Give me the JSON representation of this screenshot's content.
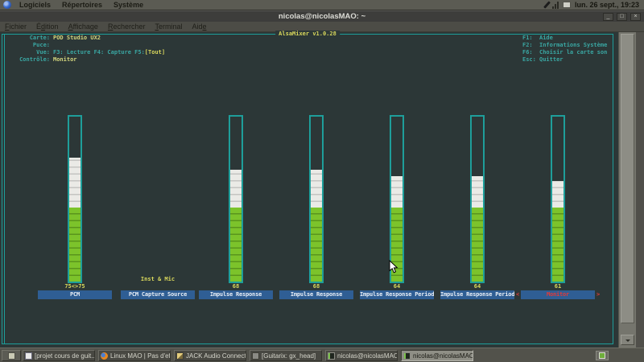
{
  "panel": {
    "menus": [
      "Logiciels",
      "Répertoires",
      "Système"
    ],
    "clock": "lun. 26 sept., 19:23"
  },
  "window": {
    "title": "nicolas@nicolasMAO: ~",
    "menus": [
      {
        "label": "Fichier",
        "u": 0
      },
      {
        "label": "Édition",
        "u": 1
      },
      {
        "label": "Affichage",
        "u": 0
      },
      {
        "label": "Rechercher",
        "u": 0
      },
      {
        "label": "Terminal",
        "u": 0
      },
      {
        "label": "Aide",
        "u": 3
      }
    ],
    "buttons": {
      "minimize": "_",
      "maximize": "□",
      "close": "×"
    }
  },
  "mixer": {
    "title": "AlsaMixer v1.0.28",
    "card_label": "Carte:",
    "card": "POD Studio UX2",
    "chip_label": "Puce:",
    "chip": "",
    "view_label": "Vue:",
    "view": "F3: Lecture  F4: Capture  F5:",
    "view_mode": "[Tout]",
    "control_label": "Contrôle:",
    "control": "Monitor",
    "help": [
      {
        "key": "F1:",
        "text": "Aide"
      },
      {
        "key": "F2:",
        "text": "Informations Système"
      },
      {
        "key": "F6:",
        "text": "Choisir la carte son"
      },
      {
        "key": "Esc:",
        "text": "Quitter"
      }
    ],
    "controls": [
      {
        "name": "PCM",
        "value": "75<>75",
        "fill": 75,
        "kind": "bar"
      },
      {
        "name": "PCM Capture Source",
        "value": "Inst & Mic",
        "kind": "enum"
      },
      {
        "name": "Impulse Response",
        "value": "68",
        "fill": 68,
        "kind": "bar"
      },
      {
        "name": "Impulse Response",
        "value": "68",
        "fill": 68,
        "kind": "bar"
      },
      {
        "name": "Impulse Response Period",
        "value": "64",
        "fill": 64,
        "kind": "bar"
      },
      {
        "name": "Impulse Response Period",
        "value": "64",
        "fill": 64,
        "kind": "bar"
      },
      {
        "name": "Monitor",
        "value": "61",
        "fill": 61,
        "kind": "bar",
        "selected": true
      }
    ],
    "colors": {
      "accent_teal": "#1e9e9a",
      "text_yellow": "#d8d75c",
      "bar_green": "#7cc32b",
      "label_blue": "#2f5e94",
      "selected_red": "#e03a3a",
      "terminal_bg": "#2c3737"
    }
  },
  "taskbar": {
    "items": [
      {
        "label": "[projet cours de guit...",
        "icon": "document-icon"
      },
      {
        "label": "Linux MAO | Pas d'eff...",
        "icon": "firefox-icon"
      },
      {
        "label": "JACK Audio Connecti...",
        "icon": "jack-icon"
      },
      {
        "label": "[Guitarix: gx_head]",
        "icon": "guitarix-icon"
      },
      {
        "label": "nicolas@nicolasMAO:...",
        "icon": "terminal-icon"
      },
      {
        "label": "nicolas@nicolasMAO: ~",
        "icon": "terminal-icon",
        "active": true
      }
    ]
  }
}
